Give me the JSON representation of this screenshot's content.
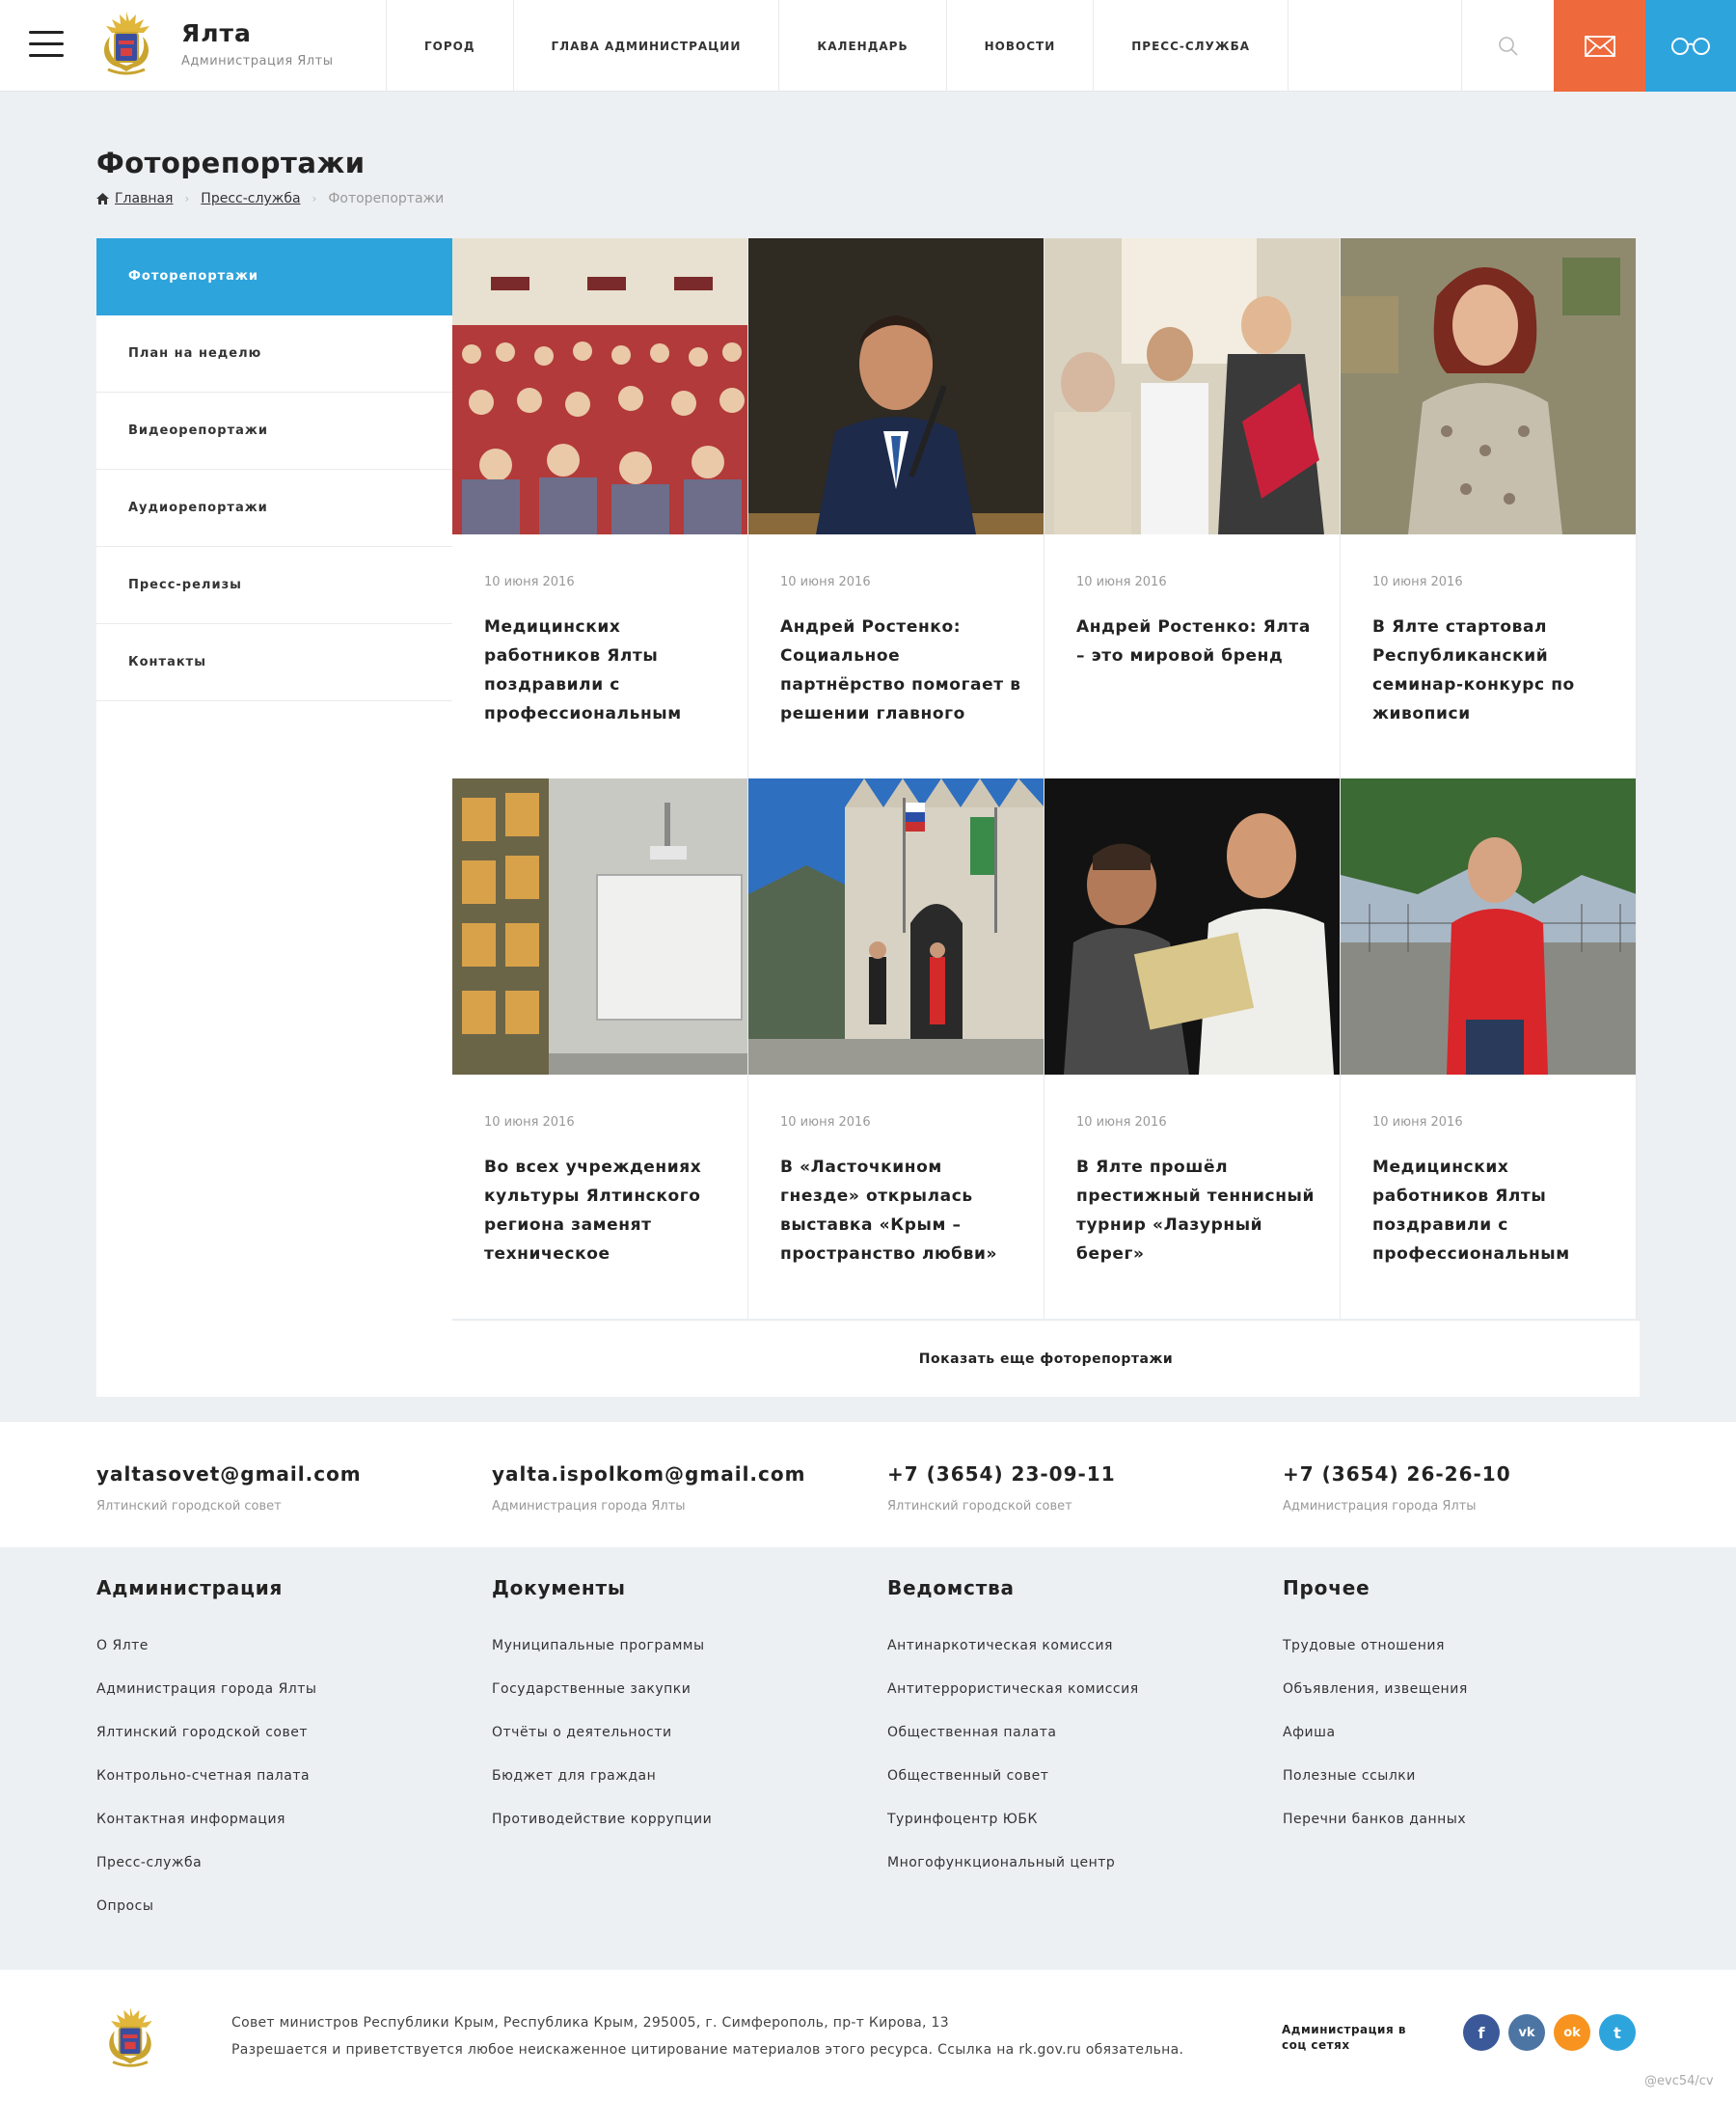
{
  "header": {
    "title": "Ялта",
    "subtitle": "Администрация Ялты",
    "nav": [
      "ГОРОД",
      "ГЛАВА АДМИНИСТРАЦИИ",
      "КАЛЕНДАРЬ",
      "НОВОСТИ",
      "ПРЕСС-СЛУЖБА"
    ],
    "icons": [
      "menu-icon",
      "search-icon",
      "mail-icon",
      "glasses-icon"
    ],
    "colors": {
      "mail": "#ee6a3c",
      "accessibility": "#2ea4dd"
    }
  },
  "page": {
    "title": "Фоторепортажи",
    "breadcrumb": {
      "home": "Главная",
      "section": "Пресс-служба",
      "current": "Фоторепортажи"
    }
  },
  "sidebar": {
    "items": [
      "Фоторепортажи",
      "План на неделю",
      "Видеорепортажи",
      "Аудиорепортажи",
      "Пресс-релизы",
      "Контакты"
    ],
    "active_index": 0
  },
  "cards": [
    {
      "date": "10 июня 2016",
      "title": "Медицинских работников Ялты поздравили с профессиональным"
    },
    {
      "date": "10 июня 2016",
      "title": "Андрей Ростенко: Социальное партнёрство помогает в решении главного"
    },
    {
      "date": "10 июня 2016",
      "title": "Андрей Ростенко: Ялта – это мировой бренд"
    },
    {
      "date": "10 июня 2016",
      "title": "В Ялте стартовал Республиканский семинар-конкурс по живописи"
    },
    {
      "date": "10 июня 2016",
      "title": "Во всех учреждениях культуры Ялтинского региона заменят техническое"
    },
    {
      "date": "10 июня 2016",
      "title": "В «Ласточкином гнезде» открылась выставка «Крым – пространство любви»"
    },
    {
      "date": "10 июня 2016",
      "title": "В Ялте прошёл престижный теннисный турнир «Лазурный берег»"
    },
    {
      "date": "10 июня 2016",
      "title": "Медицинских работников Ялты поздравили с профессиональным"
    }
  ],
  "more_label": "Показать еще фоторепортажи",
  "contacts": [
    {
      "value": "yaltasovet@gmail.com",
      "label": "Ялтинский городской совет"
    },
    {
      "value": "yalta.ispolkom@gmail.com",
      "label": "Администрация города Ялты"
    },
    {
      "value": "+7 (3654) 23-09-11",
      "label": "Ялтинский городской совет"
    },
    {
      "value": "+7 (3654) 26-26-10",
      "label": "Администрация города Ялты"
    }
  ],
  "footer_columns": [
    {
      "title": "Администрация",
      "links": [
        "О Ялте",
        "Администрация города Ялты",
        "Ялтинский городской совет",
        "Контрольно-счетная палата",
        "Контактная информация",
        "Пресс-служба",
        "Опросы"
      ]
    },
    {
      "title": "Документы",
      "links": [
        "Муниципальные программы",
        "Государственные закупки",
        "Отчёты о деятельности",
        "Бюджет для граждан",
        "Противодействие коррупции"
      ]
    },
    {
      "title": "Ведомства",
      "links": [
        "Антинаркотическая комиссия",
        "Антитеррористическая комиссия",
        "Общественная палата",
        "Общественный совет",
        "Туринфоцентр ЮБК",
        "Многофункциональный центр"
      ]
    },
    {
      "title": "Прочее",
      "links": [
        "Трудовые отношения",
        "Объявления, извещения",
        "Афиша",
        "Полезные ссылки",
        "Перечни банков данных"
      ]
    }
  ],
  "bottom": {
    "address": "Совет министров Республики Крым, Республика Крым, 295005, г. Симферополь, пр-т Кирова, 13",
    "copyright": "Разрешается и приветствуется любое неискаженное цитирование материалов этого ресурса. Ссылка на rk.gov.ru обязательна.",
    "social_label": "Администрация в соц сетях",
    "social": [
      {
        "icon": "facebook-icon",
        "glyph": "f",
        "color": "#3b5998"
      },
      {
        "icon": "vk-icon",
        "glyph": "vk",
        "color": "#4c75a3"
      },
      {
        "icon": "odnoklassniki-icon",
        "glyph": "ok",
        "color": "#f7931e"
      },
      {
        "icon": "twitter-icon",
        "glyph": "t",
        "color": "#2ea4dd"
      }
    ]
  },
  "watermark": "@evc54/cv"
}
